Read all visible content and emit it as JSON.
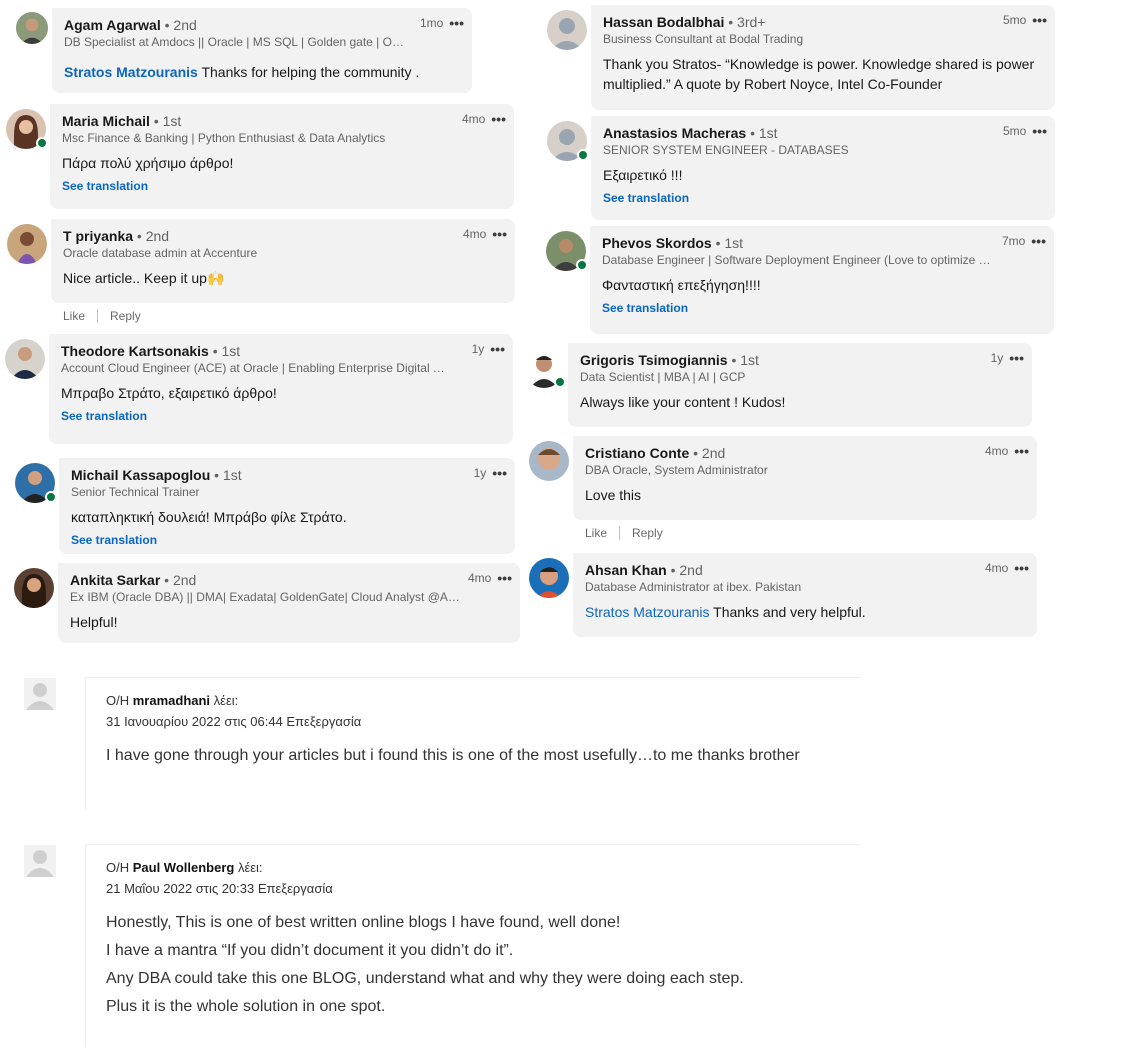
{
  "colors": {
    "link": "#0a66c2",
    "bubble": "#f2f2f2",
    "online": "#057642"
  },
  "li_left": [
    {
      "name": "Agam Agarwal",
      "degree": "• 2nd",
      "headline": "DB Specialist at Amdocs || Oracle | MS SQL | Golden gate | OCI ...",
      "time": "1mo",
      "mention": "Stratos Matzouranis",
      "text": " Thanks for helping the community .",
      "see": ""
    },
    {
      "name": "Maria Michail",
      "degree": "• 1st",
      "headline": "Msc Finance & Banking | Python Enthusiast & Data Analytics",
      "time": "4mo",
      "mention": "",
      "text": "Πάρα πολύ χρήσιμο άρθρο!",
      "see": "See translation"
    },
    {
      "name": "T priyanka",
      "degree": "• 2nd",
      "headline": "Oracle database admin at Accenture",
      "time": "4mo",
      "mention": "",
      "text": "Nice article.. Keep it up🙌",
      "see": ""
    },
    {
      "name": "Theodore Kartsonakis",
      "degree": "• 1st",
      "headline": "Account Cloud Engineer (ACE) at Oracle | Enabling Enterprise Digital Tra...",
      "time": "1y",
      "mention": "",
      "text": "Μπραβο Στράτο, εξαιρετικό άρθρο!",
      "see": "See translation"
    },
    {
      "name": "Michail Kassapoglou",
      "degree": "• 1st",
      "headline": "Senior Technical Trainer",
      "time": "1y",
      "mention": "",
      "text": "καταπληκτική δουλειά! Μπράβο φίλε Στράτο.",
      "see": "See translation"
    },
    {
      "name": "Ankita Sarkar",
      "degree": "• 2nd",
      "headline": "Ex IBM (Oracle DBA) || DMA| Exadata| GoldenGate| Cloud Analyst @Acc...",
      "time": "4mo",
      "mention": "",
      "text": "Helpful!",
      "see": ""
    }
  ],
  "li_right": [
    {
      "name": "Hassan Bodalbhai",
      "degree": "• 3rd+",
      "headline": "Business Consultant at Bodal Trading",
      "time": "5mo",
      "mention": "",
      "text": "Thank you Stratos- “Knowledge is power. Knowledge shared is power multiplied.” A quote by Robert Noyce, Intel Co-Founder",
      "see": ""
    },
    {
      "name": "Anastasios Macheras",
      "degree": "• 1st",
      "headline": "SENIOR SYSTEM ENGINEER - DATABASES",
      "time": "5mo",
      "mention": "",
      "text": "Εξαιρετικό !!!",
      "see": "See translation"
    },
    {
      "name": "Phevos Skordos",
      "degree": "• 1st",
      "headline": "Database Engineer | Software Deployment Engineer (Love to optimize S...",
      "time": "7mo",
      "mention": "",
      "text": "Φανταστική επεξήγηση!!!!",
      "see": "See translation"
    },
    {
      "name": "Grigoris Tsimogiannis",
      "degree": "• 1st",
      "headline": "Data Scientist | MBA | AI | GCP",
      "time": "1y",
      "mention": "",
      "text": "Always like your content ! Kudos!",
      "see": ""
    },
    {
      "name": "Cristiano Conte",
      "degree": "• 2nd",
      "headline": "DBA Oracle, System Administrator",
      "time": "4mo",
      "mention": "",
      "text": "Love this",
      "see": ""
    },
    {
      "name": "Ahsan Khan",
      "degree": "• 2nd",
      "headline": "Database Administrator at ibex. Pakistan",
      "time": "4mo",
      "mention": "Stratos Matzouranis",
      "text": " Thanks and very helpful.",
      "see": ""
    }
  ],
  "actions": {
    "like": "Like",
    "reply": "Reply"
  },
  "more_icon": "•••",
  "wp_comments": [
    {
      "prefix": "Ο/Η ",
      "author": "mramadhani",
      "says": " λέει:",
      "date": "31 Ιανουαρίου 2022 στις 06:44 ",
      "edit": "Επεξεργασία",
      "lines": [
        "I have gone through your articles but i found this is one of the most usefully…to me thanks brother"
      ]
    },
    {
      "prefix": "Ο/Η ",
      "author": "Paul Wollenberg",
      "says": " λέει:",
      "date": "21 Μαΐου 2022 στις 20:33 ",
      "edit": "Επεξεργασία",
      "lines": [
        "Honestly, This is one of best written online blogs I have found, well done!",
        "I have a mantra “If you didn’t document it you didn’t do it”.",
        "Any DBA could take this one BLOG, understand what and why they were doing each step.",
        "Plus it is the whole solution in one spot."
      ]
    }
  ]
}
